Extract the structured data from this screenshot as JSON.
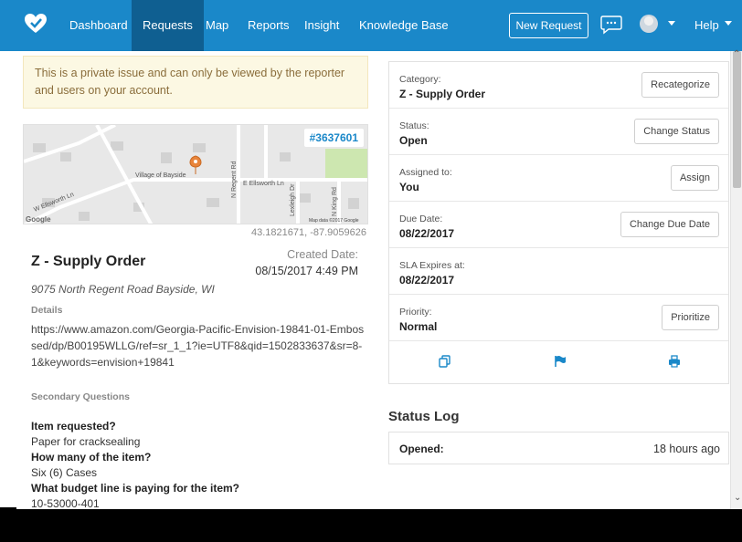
{
  "nav": {
    "items": [
      {
        "label": "Dashboard",
        "name": "nav-dashboard"
      },
      {
        "label": "Requests",
        "name": "nav-requests",
        "active": true
      },
      {
        "label": "Map",
        "name": "nav-map"
      },
      {
        "label": "Reports",
        "name": "nav-reports"
      },
      {
        "label": "Insight",
        "name": "nav-insight"
      },
      {
        "label": "Knowledge Base",
        "name": "nav-knowledge-base"
      }
    ],
    "new_request": "New Request",
    "help": "Help",
    "chat_icon": "chat-bubble-icon",
    "logo_icon": "heart-check-logo"
  },
  "colors": {
    "nav_bg": "#1a88c9",
    "nav_active": "#0f5f91",
    "notice_bg": "#fcf8e3",
    "notice_text": "#8a6d3b",
    "link_blue": "#1a88c9"
  },
  "issue": {
    "notice": "This is a private issue and can only be viewed by the reporter and users on your account.",
    "id": "#3637601",
    "map": {
      "labels": [
        "Village of Bayside",
        "E Ellsworth Ln",
        "W Ellsworth Ln",
        "N Regent Rd",
        "Lexleigh Dr",
        "N King Rd"
      ],
      "google": "Google",
      "copyright": "Map data ©2017 Google"
    },
    "coords": "43.1821671, -87.9059626",
    "title": "Z - Supply Order",
    "created_label": "Created Date:",
    "created_value": "08/15/2017 4:49 PM",
    "address": "9075 North Regent Road Bayside, WI",
    "details_heading": "Details",
    "details_text": "https://www.amazon.com/Georgia-Pacific-Envision-19841-01-Embossed/dp/B00195WLLG/ref=sr_1_1?ie=UTF8&qid=1502833637&sr=8-1&keywords=envision+19841",
    "secondary_heading": "Secondary Questions",
    "questions": [
      {
        "q": "Item requested?",
        "a": "Paper for cracksealing"
      },
      {
        "q": "How many of the item?",
        "a": "Six (6) Cases"
      },
      {
        "q": "What budget line is paying for the item?",
        "a": "10-53000-401"
      }
    ]
  },
  "sidebar": {
    "rows": [
      {
        "label": "Category:",
        "value": "Z - Supply Order",
        "button": "Recategorize",
        "name": "category"
      },
      {
        "label": "Status:",
        "value": "Open",
        "button": "Change Status",
        "name": "status"
      },
      {
        "label": "Assigned to:",
        "value": "You",
        "button": "Assign",
        "name": "assigned"
      },
      {
        "label": "Due Date:",
        "value": "08/22/2017",
        "button": "Change Due Date",
        "name": "due-date"
      },
      {
        "label": "SLA Expires at:",
        "value": "08/22/2017",
        "button": "",
        "name": "sla"
      },
      {
        "label": "Priority:",
        "value": "Normal",
        "button": "Prioritize",
        "name": "priority"
      }
    ],
    "actions": [
      "copy-icon",
      "flag-icon",
      "print-icon"
    ]
  },
  "status_log": {
    "heading": "Status Log",
    "entries": [
      {
        "event": "Opened:",
        "time": "18 hours ago"
      }
    ]
  }
}
